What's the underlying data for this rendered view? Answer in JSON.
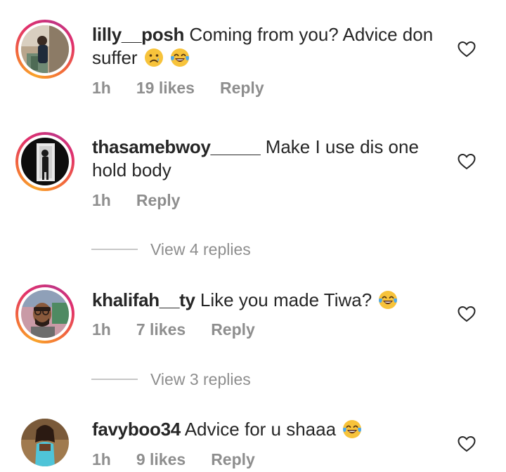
{
  "comments": [
    {
      "username": "lilly__posh",
      "text": "Coming from you? Advice don suffer",
      "emojis": [
        "crying-face",
        "tears-of-joy"
      ],
      "time": "1h",
      "likes": "19 likes",
      "reply_label": "Reply",
      "has_story_ring": true
    },
    {
      "username": "thasamebwoy_____",
      "text": "Make I use dis one hold body",
      "emojis": [],
      "time": "1h",
      "likes": "",
      "reply_label": "Reply",
      "has_story_ring": true,
      "view_replies": "View 4 replies"
    },
    {
      "username": "khalifah__ty",
      "text": "Like you made Tiwa?",
      "emojis": [
        "tears-of-joy"
      ],
      "time": "1h",
      "likes": "7 likes",
      "reply_label": "Reply",
      "has_story_ring": true,
      "view_replies": "View 3 replies"
    },
    {
      "username": "favyboo34",
      "text": "Advice for u shaaa",
      "emojis": [
        "tears-of-joy"
      ],
      "time": "1h",
      "likes": "9 likes",
      "reply_label": "Reply",
      "has_story_ring": false
    }
  ],
  "colors": {
    "text": "#262626",
    "meta": "#8e8e8e",
    "divider": "#c7c7c7"
  },
  "icons": {
    "like": "heart-outline-icon"
  }
}
